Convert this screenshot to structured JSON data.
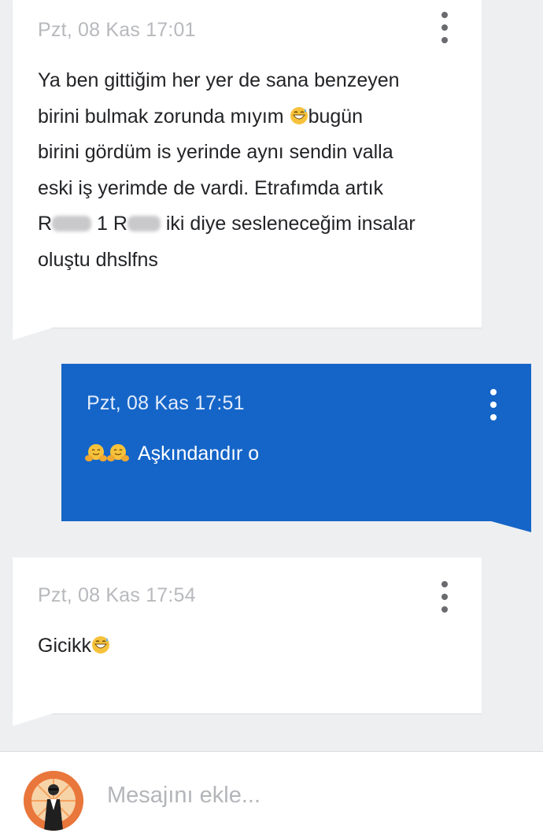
{
  "messages": [
    {
      "direction": "incoming",
      "timestamp": "Pzt, 08 Kas 17:01",
      "lines": {
        "l1": "Ya ben gittiğim her yer de sana benzeyen",
        "l2a": "birini bulmak zorunda mıyım ",
        "l2b": "bugün",
        "l3": "birini gördüm is yerinde aynı sendin valla",
        "l4": "eski iş yerimde de vardi. Etrafımda artık",
        "l5a": "R",
        "l5b": "1 R",
        "l5c": "iki diye sesleneceğim insalar",
        "l6": "oluştu dhslfns"
      },
      "emoji": "grinning-sweat-emoji"
    },
    {
      "direction": "outgoing",
      "timestamp": "Pzt, 08 Kas 17:51",
      "text": "Aşkındandır o",
      "emoji": "hugging-face-emoji"
    },
    {
      "direction": "incoming",
      "timestamp": "Pzt, 08 Kas 17:54",
      "text": "Gicikk",
      "emoji": "grinning-sweat-emoji"
    }
  ],
  "composer": {
    "placeholder": "Mesajını ekle..."
  },
  "colors": {
    "background": "#eeeff1",
    "incoming_bubble": "#ffffff",
    "outgoing_bubble": "#1565c8",
    "timestamp_incoming": "#b7b9bd",
    "avatar_ring": "#e8743a"
  }
}
